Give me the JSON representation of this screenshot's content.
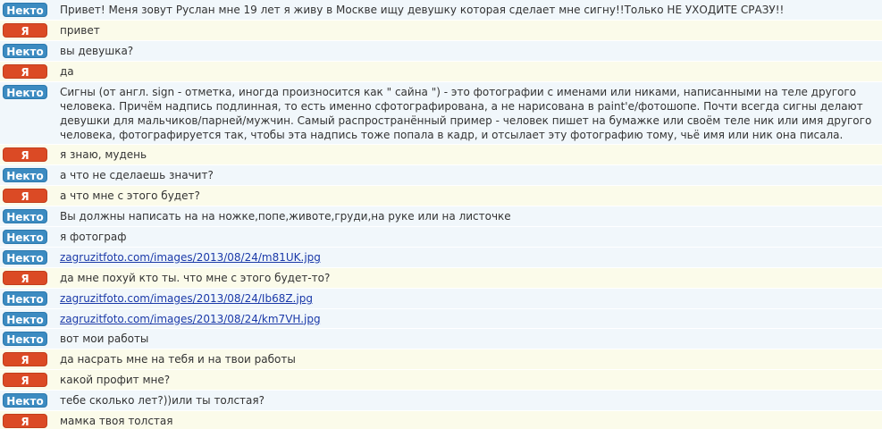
{
  "chat": {
    "labels": {
      "stranger": "Некто",
      "me": "Я"
    },
    "messages": [
      {
        "from": "stranger",
        "text": "Привет! Меня зовут Руслан мне 19 лет я живу в Москве ищу девушку которая сделает мне сигну!!Только НЕ УХОДИТЕ СРАЗУ!!"
      },
      {
        "from": "me",
        "text": "привет"
      },
      {
        "from": "stranger",
        "text": "вы девушка?"
      },
      {
        "from": "me",
        "text": "да"
      },
      {
        "from": "stranger",
        "text": "Сигны (от англ. sign - отметка, иногда произносится как \" сайна \") - это фотографии с именами или никами, написанными на теле другого человека. Причём надпись подлинная, то есть именно сфотографирована, а не нарисована в paint'е/фотошопе. Почти всегда сигны делают девушки для мальчиков/парней/мужчин. Самый распространённый пример - человек пишет на бумажке или своём теле ник или имя другого человека, фотографируется так, чтобы эта надпись тоже попала в кадр, и отсылает эту фотографию тому, чьё имя или ник она писала."
      },
      {
        "from": "me",
        "text": "я знаю, мудень"
      },
      {
        "from": "stranger",
        "text": "а что не сделаешь значит?"
      },
      {
        "from": "me",
        "text": "а что мне с этого будет?"
      },
      {
        "from": "stranger",
        "text": "Вы должны написать на на ножке,попе,животе,груди,на руке или на листочке"
      },
      {
        "from": "stranger",
        "text": "я фотограф"
      },
      {
        "from": "stranger",
        "text": "zagruzitfoto.com/images/2013/08/24/m81UK.jpg",
        "link": true
      },
      {
        "from": "me",
        "text": "да мне похуй кто ты. что мне с этого будет-то?"
      },
      {
        "from": "stranger",
        "text": "zagruzitfoto.com/images/2013/08/24/Ib68Z.jpg",
        "link": true
      },
      {
        "from": "stranger",
        "text": "zagruzitfoto.com/images/2013/08/24/km7VH.jpg",
        "link": true
      },
      {
        "from": "stranger",
        "text": "вот мои работы"
      },
      {
        "from": "me",
        "text": "да насрать мне на тебя и на твои работы"
      },
      {
        "from": "me",
        "text": "какой профит мне?"
      },
      {
        "from": "stranger",
        "text": "тебе сколько лет?))или ты толстая?"
      },
      {
        "from": "me",
        "text": "мамка твоя толстая"
      }
    ]
  },
  "colors": {
    "stranger_badge": "#3c8bc1",
    "me_badge": "#db4a25",
    "stranger_row": "#f1f7fb",
    "me_row": "#fbfbea",
    "link": "#1b3aa9"
  }
}
